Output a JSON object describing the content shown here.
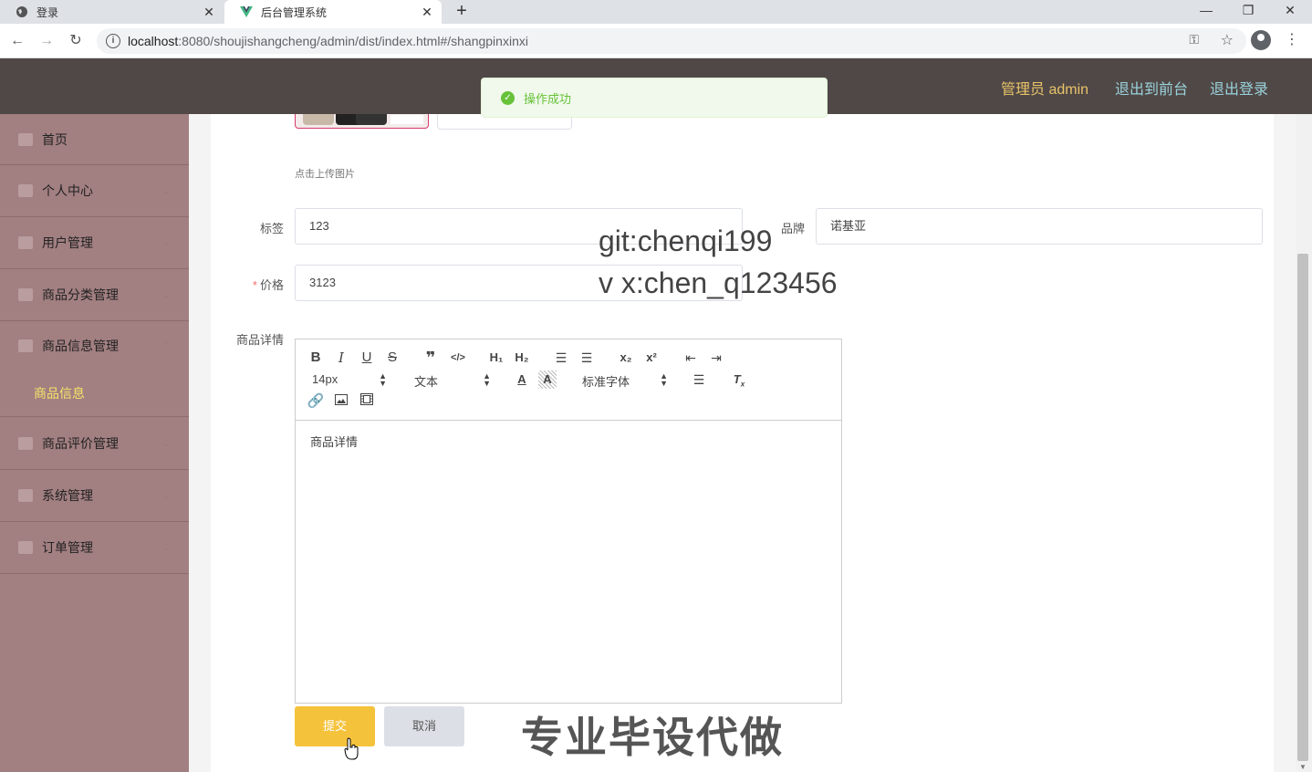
{
  "browser": {
    "tabs": [
      {
        "title": "登录",
        "icon": "globe-icon"
      },
      {
        "title": "后台管理系统",
        "icon": "vue-logo-icon"
      }
    ],
    "url_host": "localhost",
    "url_rest": ":8080/shoujishangcheng/admin/dist/index.html#/shangpinxinxi"
  },
  "header": {
    "user": "管理员 admin",
    "to_front": "退出到前台",
    "logout": "退出登录"
  },
  "toast": {
    "message": "操作成功",
    "color": "#67c23a"
  },
  "sidebar": {
    "items": [
      {
        "label": "首页",
        "icon": "home-icon"
      },
      {
        "label": "个人中心",
        "icon": "user-icon"
      },
      {
        "label": "用户管理",
        "icon": "document-icon"
      },
      {
        "label": "商品分类管理",
        "icon": "grid-icon"
      },
      {
        "label": "商品信息管理",
        "icon": "folder-icon"
      },
      {
        "label": "商品评价管理",
        "icon": "copy-icon"
      },
      {
        "label": "系统管理",
        "icon": "monitor-icon"
      },
      {
        "label": "订单管理",
        "icon": "power-icon"
      }
    ],
    "active_sub": "商品信息",
    "active_color": "#f7e36a",
    "bg_color": "#a27f81"
  },
  "form": {
    "upload_tip": "点击上传图片",
    "tag_label": "标签",
    "tag_value": "123",
    "brand_label": "品牌",
    "brand_value": "诺基亚",
    "price_required": "*",
    "price_label": "价格",
    "price_value": "3123",
    "detail_label": "商品详情",
    "editor": {
      "font_size": "14px",
      "text_type": "文本",
      "font_family": "标准字体",
      "content": "商品详情"
    },
    "submit": "提交",
    "cancel": "取消",
    "submit_color": "#f5c23b"
  },
  "watermarks": {
    "line1": "git:chenqi199",
    "line2": "v x:chen_q123456",
    "line3": "专业毕设代做"
  }
}
